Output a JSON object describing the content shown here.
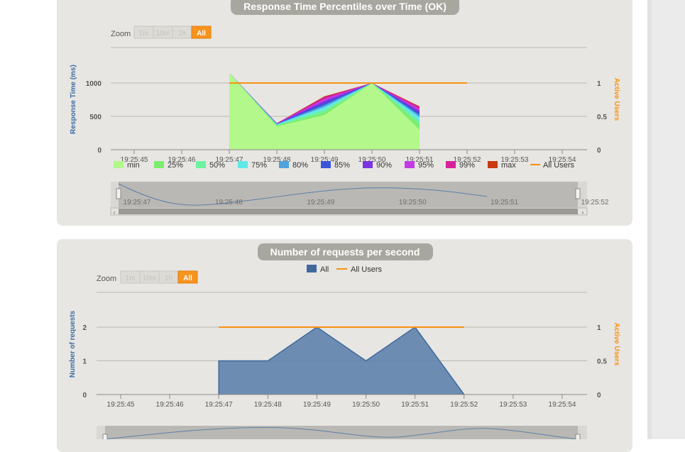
{
  "colors": {
    "panel_bg": "#e7e6e2",
    "title_pill": "#a8a79f",
    "active_users": "#f79212",
    "requests_fill": "#5b7fab",
    "requests_line": "#41699c",
    "zoom_active": "#f7931e",
    "axis_left_label": "#3c6ea3",
    "axis_right_label": "#f79212"
  },
  "chart_data": [
    {
      "type": "area",
      "title": "Response Time Percentiles over Time (OK)",
      "zoom": {
        "label": "Zoom",
        "buttons": [
          "1m",
          "10m",
          "1h",
          "All"
        ],
        "active": "All"
      },
      "ylabel": "Response Time (ms)",
      "y2label": "Active Users",
      "ylim": [
        0,
        1000
      ],
      "y_ticks": [
        "0",
        "500",
        "1000"
      ],
      "y2_ticks": [
        "0",
        "0.5",
        "1"
      ],
      "x_ticks": [
        "19:25:45",
        "19:25:46",
        "19:25:47",
        "19:25:48",
        "19:25:49",
        "19:25:50",
        "19:25:51",
        "19:25:52",
        "19:25:53",
        "19:25:54"
      ],
      "x": [
        "19:25:47",
        "19:25:48",
        "19:25:49",
        "19:25:50",
        "19:25:51"
      ],
      "series": [
        {
          "name": "min",
          "color": "#b2f88a",
          "values": [
            1150,
            350,
            520,
            1000,
            300
          ]
        },
        {
          "name": "25%",
          "color": "#7ced6e",
          "values": [
            1150,
            360,
            560,
            1000,
            380
          ]
        },
        {
          "name": "50%",
          "color": "#6ef2a2",
          "values": [
            1150,
            370,
            600,
            1000,
            430
          ]
        },
        {
          "name": "75%",
          "color": "#63e8ea",
          "values": [
            1150,
            380,
            640,
            1000,
            490
          ]
        },
        {
          "name": "80%",
          "color": "#4ea3dd",
          "values": [
            1150,
            385,
            670,
            1000,
            520
          ]
        },
        {
          "name": "85%",
          "color": "#3a56d8",
          "values": [
            1150,
            390,
            700,
            1000,
            550
          ]
        },
        {
          "name": "90%",
          "color": "#7a33e0",
          "values": [
            1150,
            392,
            730,
            1000,
            580
          ]
        },
        {
          "name": "95%",
          "color": "#c23ce6",
          "values": [
            1150,
            394,
            760,
            1000,
            610
          ]
        },
        {
          "name": "99%",
          "color": "#d7239a",
          "values": [
            1150,
            396,
            790,
            1000,
            640
          ]
        },
        {
          "name": "max",
          "color": "#c9380e",
          "values": [
            1150,
            398,
            800,
            1000,
            650
          ]
        }
      ],
      "active_users": {
        "name": "All Users",
        "x": [
          "19:25:47",
          "19:25:52"
        ],
        "values": [
          1,
          1
        ]
      },
      "navigator_ticks": [
        "19:25:47",
        "19:25:48",
        "19:25:49",
        "19:25:50",
        "19:25:51",
        "19:25:52"
      ]
    },
    {
      "type": "area",
      "title": "Number of requests per second",
      "zoom": {
        "label": "Zoom",
        "buttons": [
          "1m",
          "10m",
          "1h",
          "All"
        ],
        "active": "All"
      },
      "ylabel": "Number of requests",
      "y2label": "Active Users",
      "ylim": [
        0,
        2
      ],
      "y_ticks": [
        "0",
        "1",
        "2"
      ],
      "y2_ticks": [
        "0",
        "0.5",
        "1"
      ],
      "x_ticks": [
        "19:25:45",
        "19:25:46",
        "19:25:47",
        "19:25:48",
        "19:25:49",
        "19:25:50",
        "19:25:51",
        "19:25:52",
        "19:25:53",
        "19:25:54"
      ],
      "legend": [
        "All",
        "All Users"
      ],
      "series": [
        {
          "name": "All",
          "x": [
            "19:25:47",
            "19:25:48",
            "19:25:49",
            "19:25:50",
            "19:25:51",
            "19:25:52"
          ],
          "values": [
            1,
            1,
            2,
            1,
            2,
            0
          ]
        }
      ],
      "active_users": {
        "name": "All Users",
        "x": [
          "19:25:47",
          "19:25:52"
        ],
        "values": [
          1,
          1
        ]
      }
    }
  ]
}
